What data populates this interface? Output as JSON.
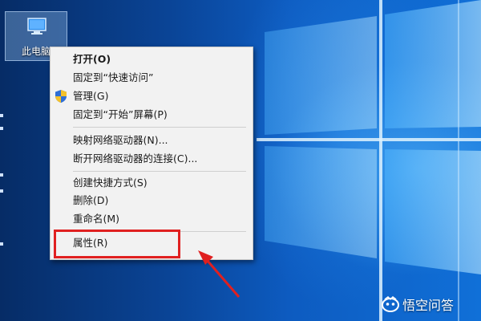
{
  "desktop": {
    "icon_label": "此电脑"
  },
  "context_menu": {
    "items": [
      {
        "label": "打开(O)",
        "bold": true
      },
      {
        "label": "固定到“快速访问”"
      },
      {
        "label": "管理(G)",
        "icon": "shield-icon"
      },
      {
        "label": "固定到“开始”屏幕(P)"
      },
      {
        "label": "映射网络驱动器(N)..."
      },
      {
        "label": "断开网络驱动器的连接(C)..."
      },
      {
        "label": "创建快捷方式(S)"
      },
      {
        "label": "删除(D)"
      },
      {
        "label": "重命名(M)"
      },
      {
        "label": "属性(R)"
      }
    ]
  },
  "annotation": {
    "highlight_color": "#e02020"
  },
  "watermark": {
    "text": "悟空问答"
  }
}
